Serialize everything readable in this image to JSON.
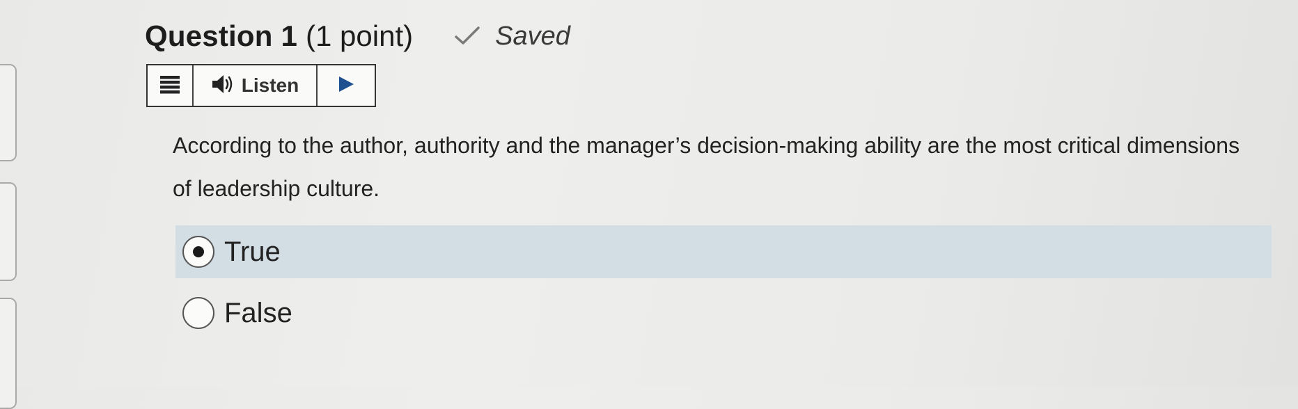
{
  "question": {
    "title": "Question 1",
    "points": "(1 point)",
    "status": "Saved",
    "status_icon": "check-icon",
    "text": "According to the author, authority and the manager’s decision-making ability are the most critical dimensions of leadership culture."
  },
  "listen_toolbar": {
    "menu_icon": "menu-icon",
    "speaker_icon": "speaker-icon",
    "listen_label": "Listen",
    "play_icon": "play-icon"
  },
  "options": [
    {
      "label": "True",
      "selected": true
    },
    {
      "label": "False",
      "selected": false
    }
  ],
  "colors": {
    "selected_option_bg": "#d3dde4",
    "text": "#222222",
    "check": "#777777"
  }
}
